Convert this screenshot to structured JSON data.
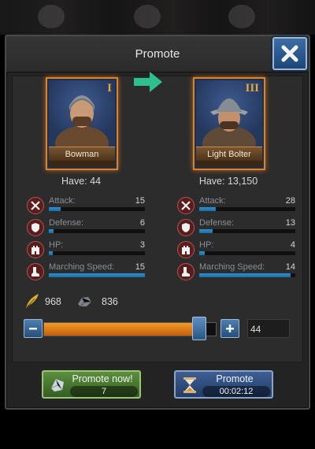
{
  "dialog": {
    "title": "Promote"
  },
  "from_unit": {
    "name": "Bowman",
    "rank": "I",
    "have": "Have: 44",
    "stats": [
      {
        "label": "Attack:",
        "value": "15",
        "fill": 0.12,
        "icon": "crossed-swords-icon"
      },
      {
        "label": "Defense:",
        "value": "6",
        "fill": 0.05,
        "icon": "shield-icon"
      },
      {
        "label": "HP:",
        "value": "3",
        "fill": 0.04,
        "icon": "castle-icon"
      },
      {
        "label": "Marching Speed:",
        "value": "15",
        "fill": 1.0,
        "icon": "boot-icon"
      }
    ]
  },
  "to_unit": {
    "name": "Light Bolter",
    "rank": "III",
    "have": "Have: 13,150",
    "stats": [
      {
        "label": "Attack:",
        "value": "28",
        "fill": 0.17,
        "icon": "crossed-swords-icon"
      },
      {
        "label": "Defense:",
        "value": "13",
        "fill": 0.14,
        "icon": "shield-icon"
      },
      {
        "label": "HP:",
        "value": "4",
        "fill": 0.06,
        "icon": "castle-icon"
      },
      {
        "label": "Marching Speed:",
        "value": "14",
        "fill": 0.95,
        "icon": "boot-icon"
      }
    ]
  },
  "resources": {
    "feather": "968",
    "ore": "836"
  },
  "slider": {
    "quantity": "44",
    "fill": 0.9
  },
  "buttons": {
    "promote_now": {
      "label": "Promote now!",
      "cost": "7"
    },
    "promote": {
      "label": "Promote",
      "time": "00:02:12"
    }
  },
  "colors": {
    "card_border": "#d9842a",
    "bar_blue": "#2f8ed0",
    "slider_orange": "#f09a2a",
    "arrow_green": "#2fbf8f"
  }
}
